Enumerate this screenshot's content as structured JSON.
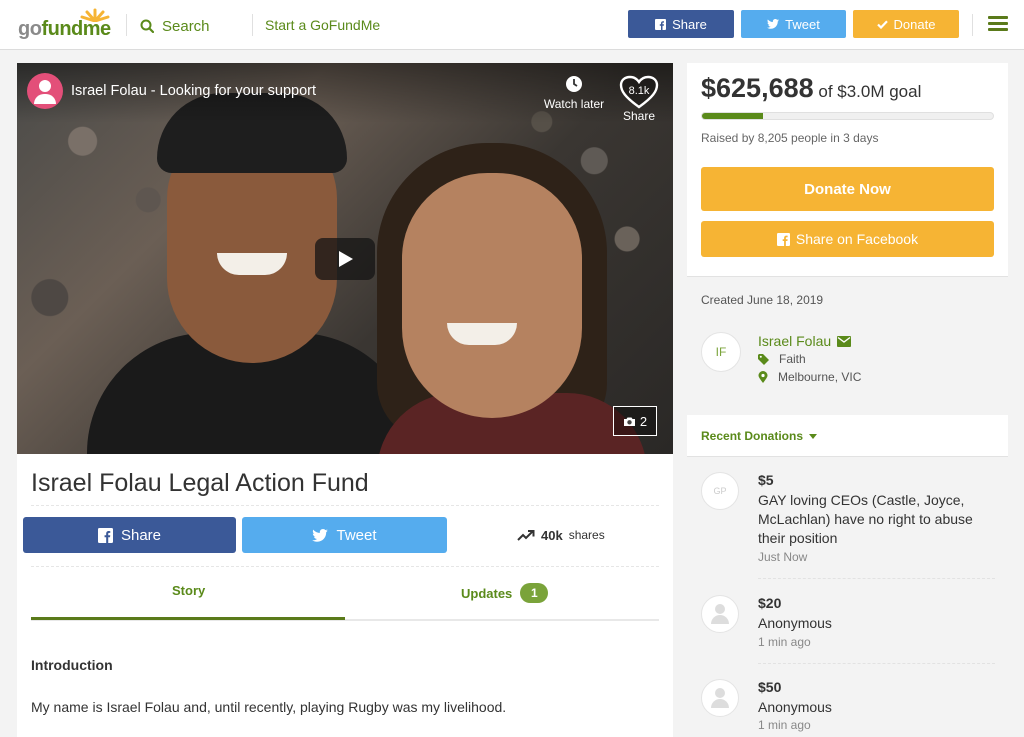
{
  "header": {
    "logo_go": "go",
    "logo_fund": "fundme",
    "search_label": "Search",
    "start_label": "Start a GoFundMe",
    "share_label": "Share",
    "tweet_label": "Tweet",
    "donate_label": "Donate",
    "colors": {
      "brand_green": "#5a8a1a",
      "facebook": "#3b5998",
      "twitter": "#55acee",
      "donate": "#f6b434"
    }
  },
  "video": {
    "title": "Israel Folau - Looking for your support",
    "watch_later": "Watch later",
    "share_count": "8.1k",
    "share_label": "Share",
    "photo_count": "2"
  },
  "campaign": {
    "title": "Israel Folau Legal Action Fund",
    "share_label": "Share",
    "tweet_label": "Tweet",
    "shares_count": "40k",
    "shares_label": "shares",
    "tabs": [
      {
        "label": "Story"
      },
      {
        "label": "Updates",
        "badge": "1"
      }
    ],
    "intro_heading": "Introduction",
    "intro_text": "My name is Israel Folau and, until recently, playing Rugby was my livelihood."
  },
  "goal": {
    "raised": "$625,688",
    "goal_text": "of $3.0M goal",
    "progress_percent": 21,
    "raised_by": "Raised by 8,205 people in 3 days",
    "donate_now": "Donate Now",
    "share_facebook": "Share on Facebook"
  },
  "organizer": {
    "created": "Created June 18, 2019",
    "initials": "IF",
    "name": "Israel Folau",
    "category": "Faith",
    "location": "Melbourne, VIC"
  },
  "recent": {
    "title": "Recent Donations",
    "donations": [
      {
        "avatar": "GP",
        "amount": "$5",
        "donor": "GAY loving CEOs (Castle, Joyce, McLachlan) have no right to abuse their position",
        "time": "Just Now"
      },
      {
        "amount": "$20",
        "donor": "Anonymous",
        "time": "1 min ago"
      },
      {
        "amount": "$50",
        "donor": "Anonymous",
        "time": "1 min ago"
      }
    ]
  }
}
